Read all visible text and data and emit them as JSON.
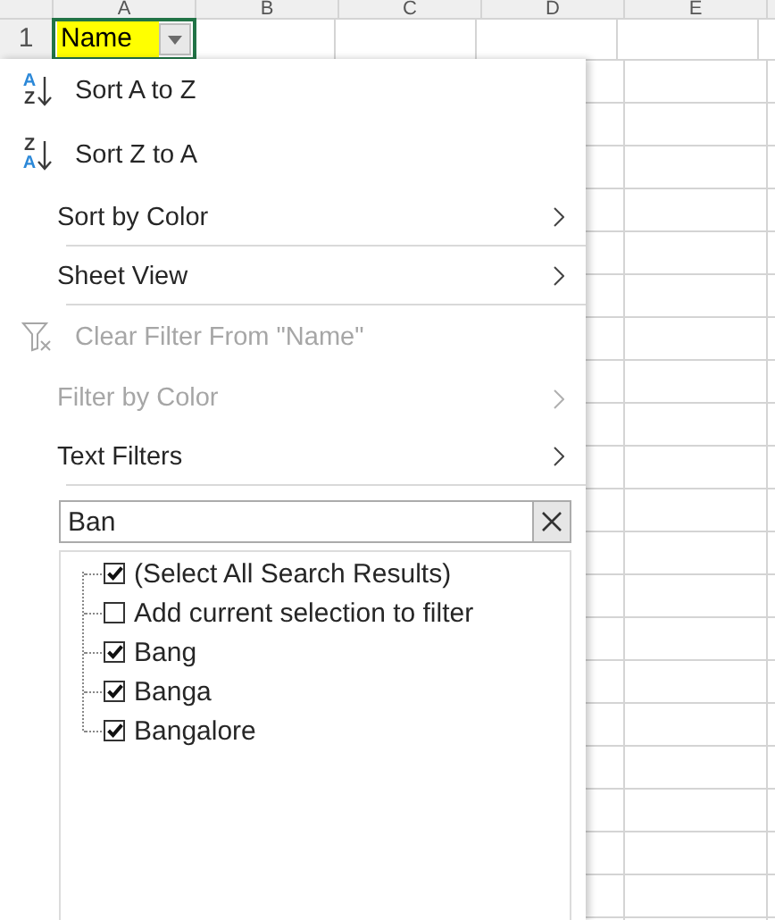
{
  "columns": [
    "A",
    "B",
    "C",
    "D",
    "E"
  ],
  "row": {
    "number": "1",
    "cell": {
      "text": "Name",
      "selected": true,
      "filter_button": true
    }
  },
  "menu": {
    "items": [
      {
        "kind": "sort",
        "label": "Sort A to Z",
        "icon_top": "A",
        "icon_bottom": "Z",
        "disabled": false,
        "separator_after": false
      },
      {
        "kind": "sort",
        "label": "Sort Z to A",
        "icon_top": "Z",
        "icon_bottom": "A",
        "disabled": false,
        "separator_after": false
      },
      {
        "kind": "submenu",
        "label": "Sort by Color",
        "disabled": false,
        "separator_after": true
      },
      {
        "kind": "submenu",
        "label": "Sheet View",
        "disabled": false,
        "separator_after": true
      },
      {
        "kind": "clear",
        "label": "Clear Filter From \"Name\"",
        "disabled": true,
        "separator_after": false
      },
      {
        "kind": "submenu",
        "label": "Filter by Color",
        "disabled": true,
        "separator_after": false
      },
      {
        "kind": "submenu",
        "label": "Text Filters",
        "disabled": false,
        "separator_after": true
      }
    ],
    "search": {
      "value": "Ban"
    },
    "values": [
      {
        "label": "(Select All Search Results)",
        "checked": true
      },
      {
        "label": "Add current selection to filter",
        "checked": false
      },
      {
        "label": "Bang",
        "checked": true
      },
      {
        "label": "Banga",
        "checked": true
      },
      {
        "label": "Bangalore",
        "checked": true
      }
    ]
  }
}
